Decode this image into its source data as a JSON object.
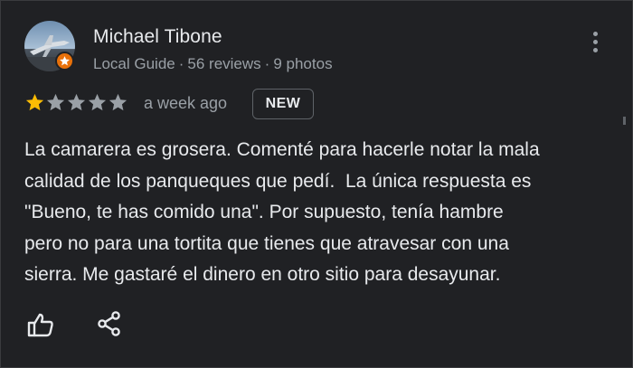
{
  "reviewer": {
    "name": "Michael Tibone",
    "badge": "Local Guide",
    "reviews": "56 reviews",
    "photos": "9 photos",
    "separator": "·",
    "avatar_icon": "airplane-photo-avatar",
    "guide_icon": "local-guide-star-icon"
  },
  "rating": {
    "value": 1,
    "max": 5,
    "filled_color": "#fbbc04",
    "empty_color": "#9aa0a6"
  },
  "time_ago": "a week ago",
  "new_badge": "NEW",
  "review_text": [
    "La camarera es grosera. Comenté para hacerle notar la mala",
    "calidad de los panqueques que pedí.  La única respuesta es",
    "\"Bueno, te has comido una\". Por supuesto, tenía hambre",
    "pero no para una tortita que tienes que atravesar con una",
    "sierra. Me gastaré el dinero en otro sitio para desayunar."
  ],
  "actions": {
    "like_icon": "thumbs-up-icon",
    "share_icon": "share-icon",
    "more_icon": "more-vert-icon"
  }
}
